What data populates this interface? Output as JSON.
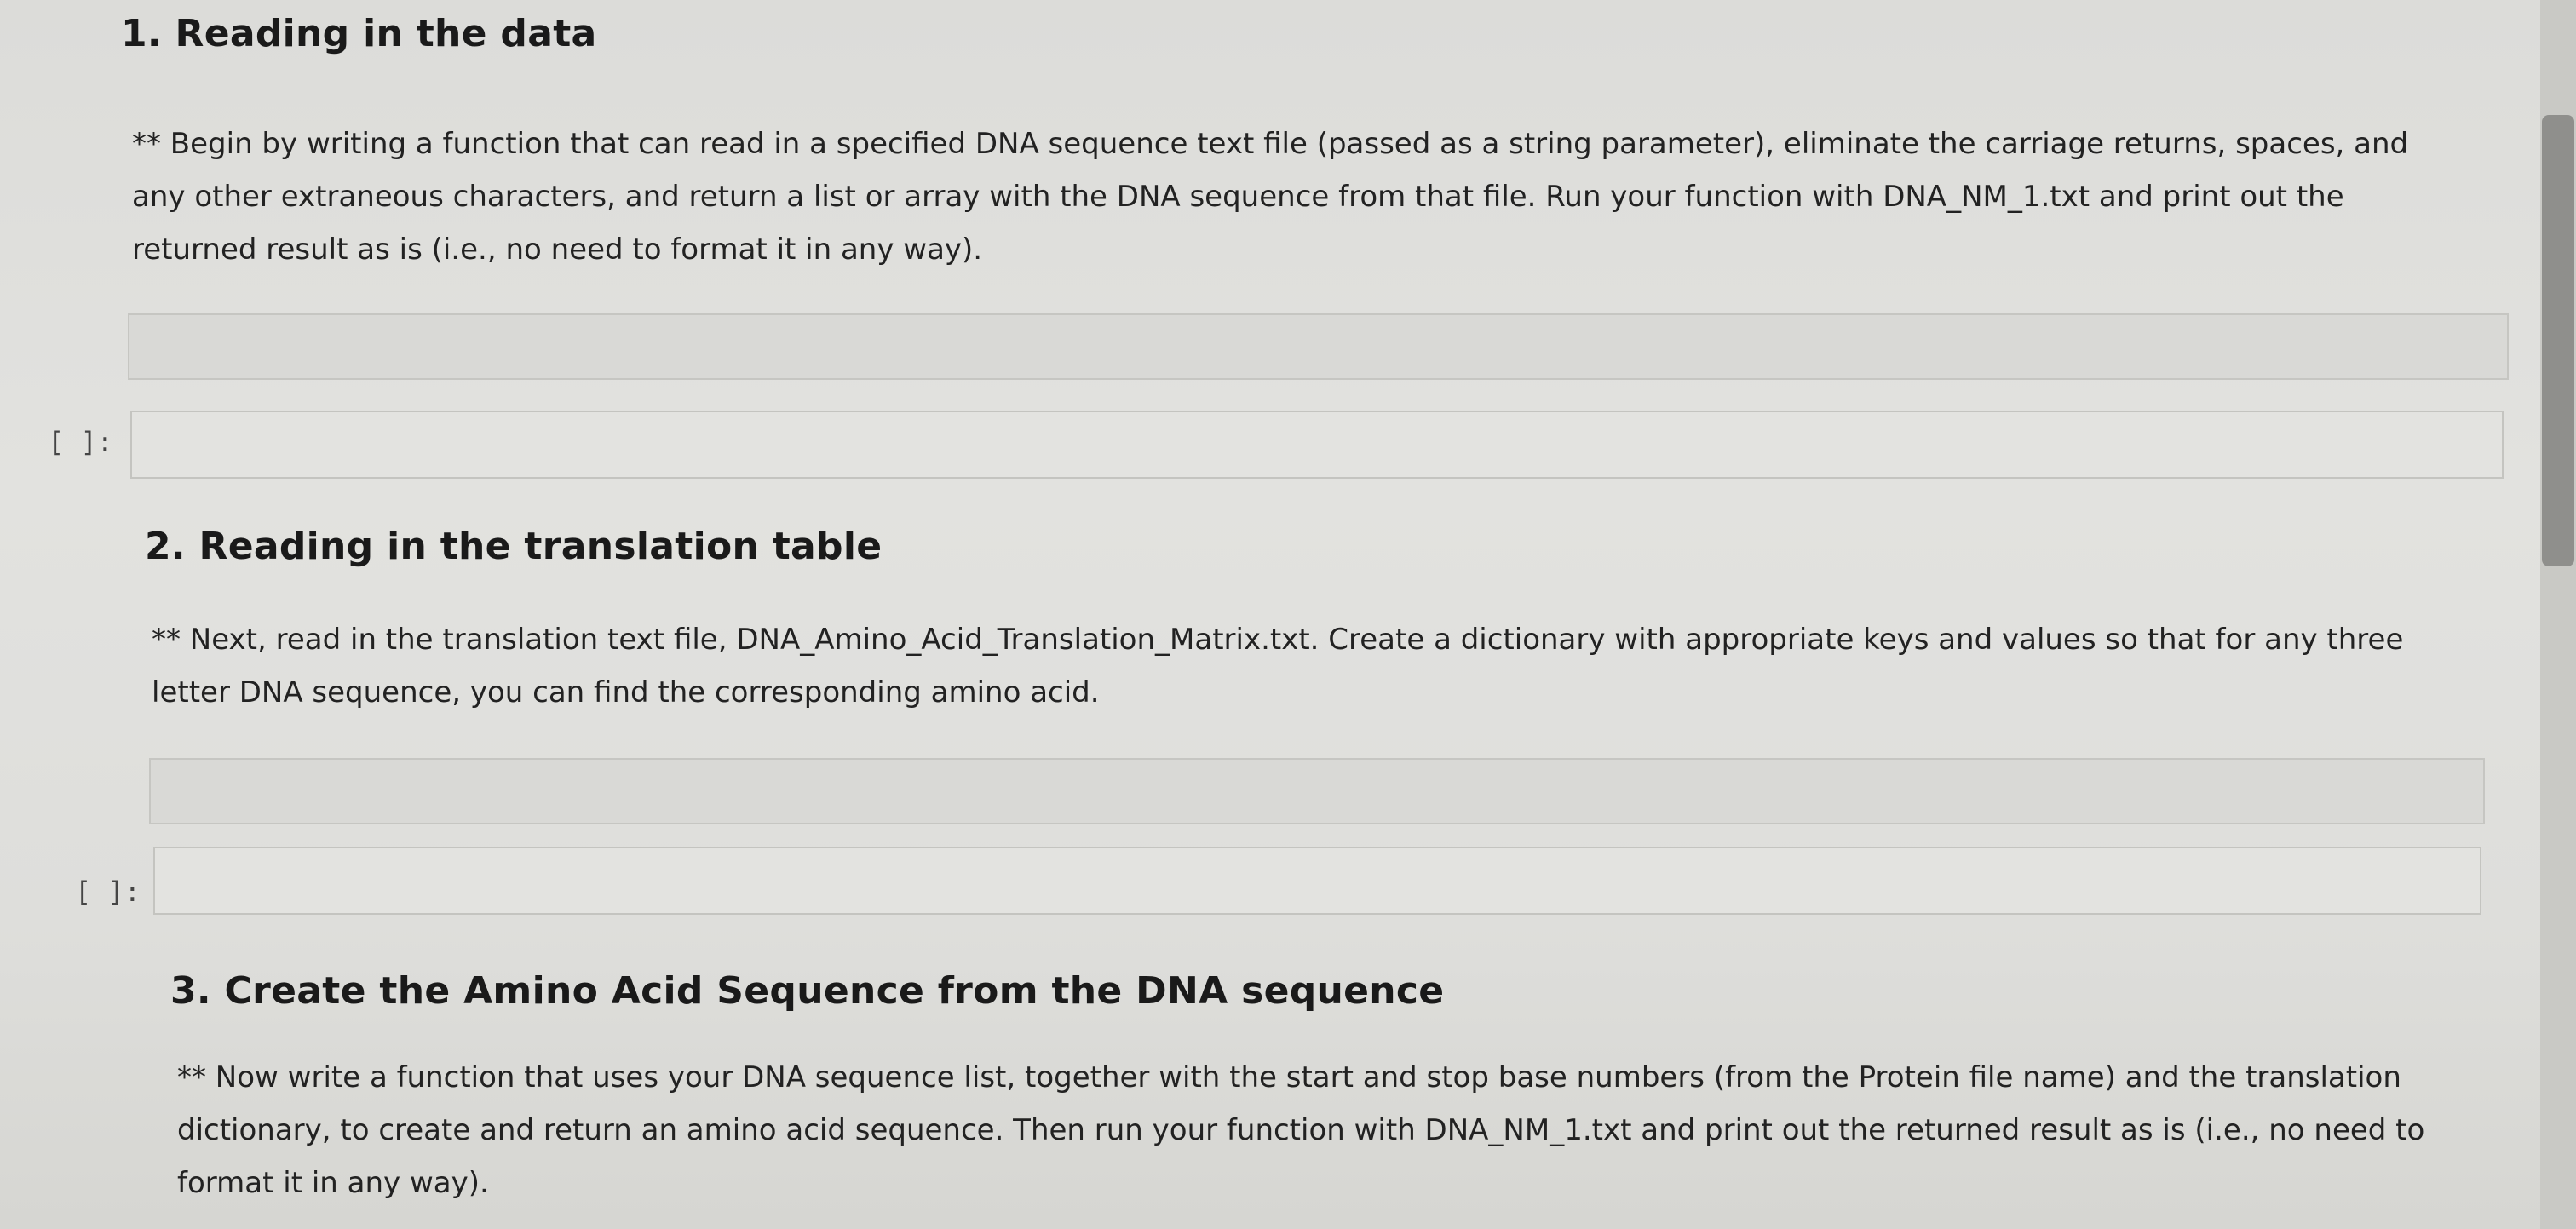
{
  "sections": [
    {
      "heading": "1. Reading in the data",
      "description_lines": [
        "** Begin by writing a function that can read in a specified DNA sequence text file (passed as a string parameter), eliminate the carriage returns, spaces, and",
        "any other extraneous characters, and return a list or array with the DNA sequence from that file. Run your function with DNA_NM_1.txt and print out the",
        "returned result as is (i.e., no need to format it in any way)."
      ],
      "code_prompt": "[ ]:",
      "code_value": ""
    },
    {
      "heading": "2. Reading in the translation table",
      "description_lines": [
        "** Next, read in the translation text file, DNA_Amino_Acid_Translation_Matrix.txt. Create a dictionary with appropriate keys and values so that for any three",
        "letter DNA sequence, you can find the corresponding amino acid."
      ],
      "code_prompt": "[ ]:",
      "code_value": ""
    },
    {
      "heading": "3. Create the Amino Acid Sequence from the DNA sequence",
      "description_lines": [
        "** Now write a function that uses your DNA sequence list, together with the start and stop base numbers (from the Protein file name) and the translation",
        "dictionary, to create and return an amino acid sequence. Then run your function with DNA_NM_1.txt and print out the returned result as is (i.e., no need to",
        "format it in any way)."
      ]
    }
  ]
}
